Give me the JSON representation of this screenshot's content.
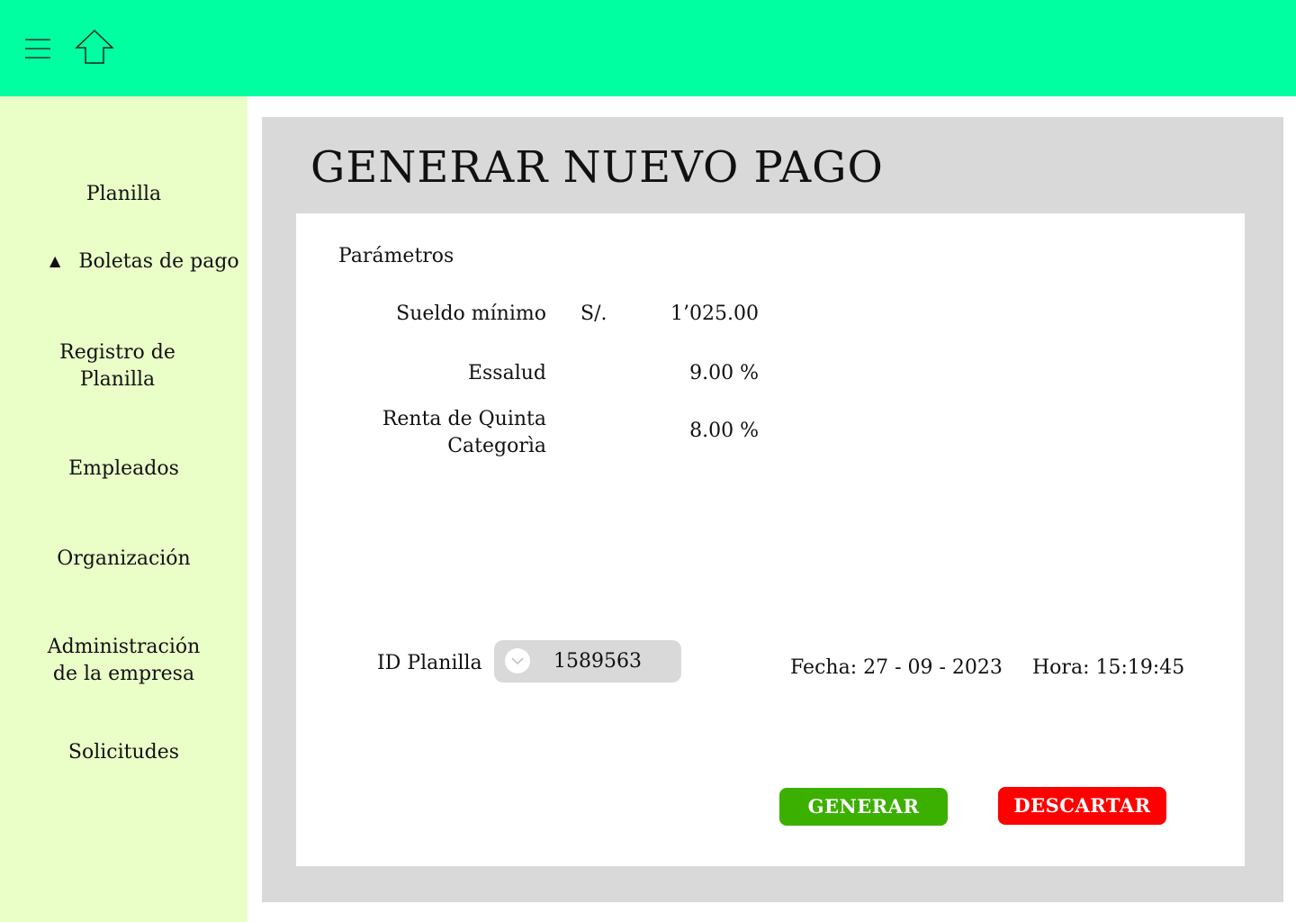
{
  "header": {
    "menu_icon": "hamburger-menu-icon",
    "home_icon": "home-arrow-icon",
    "background_color": "#00ffa0"
  },
  "sidebar": {
    "background_color": "#eaffc8",
    "items": [
      {
        "label": "Planilla"
      },
      {
        "label": "Boletas de pago",
        "expanded_icon": "triangle-up-icon",
        "arrow": "▲"
      },
      {
        "label": "Registro de\nPlanilla"
      },
      {
        "label": "Empleados"
      },
      {
        "label": "Organización"
      },
      {
        "label": "Administración\nde la empresa"
      },
      {
        "label": "Solicitudes"
      }
    ]
  },
  "main": {
    "title": "GENERAR NUEVO PAGO",
    "parameters": {
      "section_title": "Parámetros",
      "rows": [
        {
          "label": "Sueldo mínimo",
          "currency": "S/.",
          "value": "1’025.00"
        },
        {
          "label": "Essalud",
          "value": "9.00 %"
        },
        {
          "label": "Renta de Quinta\nCategorìa",
          "value": "8.00 %"
        }
      ]
    },
    "id_planilla": {
      "label": "ID Planilla",
      "value": "1589563",
      "icon": "chevron-down-icon"
    },
    "fecha": "Fecha: 27 - 09 - 2023",
    "hora": "Hora: 15:19:45",
    "buttons": {
      "generar": "GENERAR",
      "descartar": "DESCARTAR"
    },
    "colors": {
      "generar": "#3cb000",
      "descartar": "#ff0000",
      "panel": "#d9d9d9"
    }
  }
}
